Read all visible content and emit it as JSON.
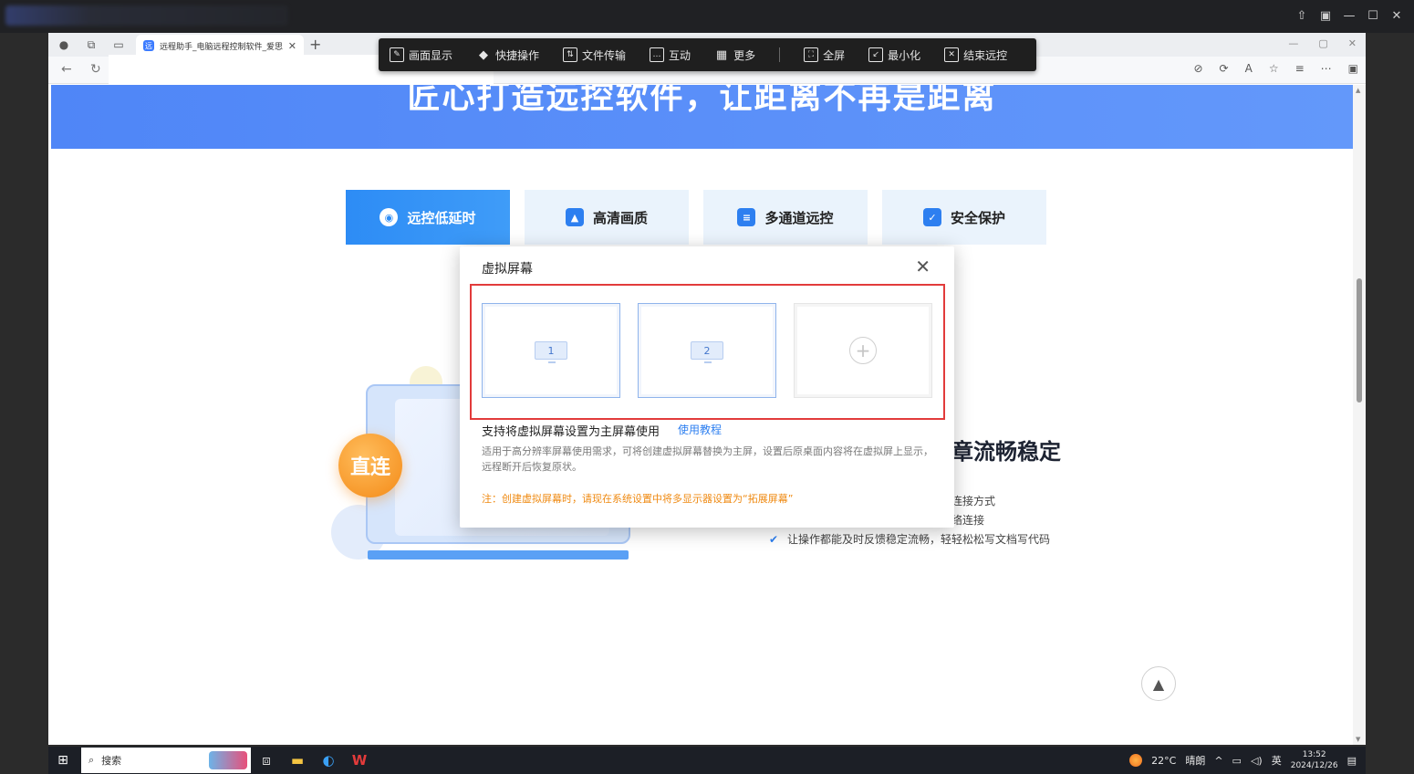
{
  "browser": {
    "tab_title": "远程助手_电脑远程控制软件_爱思",
    "tab_favicon": "远"
  },
  "remote_toolbar": {
    "items": [
      {
        "label": "画面显示",
        "icon": "display-icon"
      },
      {
        "label": "快捷操作",
        "icon": "shortcut-icon"
      },
      {
        "label": "文件传输",
        "icon": "file-transfer-icon"
      },
      {
        "label": "互动",
        "icon": "chat-icon"
      },
      {
        "label": "更多",
        "icon": "grid-icon"
      },
      {
        "label": "全屏",
        "icon": "fullscreen-icon"
      },
      {
        "label": "最小化",
        "icon": "minimize-icon"
      },
      {
        "label": "结束远控",
        "icon": "close-box-icon"
      }
    ]
  },
  "page": {
    "hero_title": "匠心打造远控软件，让距离不再是距离",
    "feature_tabs": [
      {
        "label": "远控低延时",
        "active": true
      },
      {
        "label": "高清画质",
        "active": false
      },
      {
        "label": "多通道远控",
        "active": false
      },
      {
        "label": "安全保护",
        "active": false
      }
    ],
    "illustration_badge": "直连",
    "feature_heading": "章流畅稳定",
    "bullets": [
      "连接方式",
      "络连接",
      "让操作都能及时反馈稳定流畅，轻轻松松写文档写代码"
    ]
  },
  "dialog": {
    "title": "虚拟屏幕",
    "screens": [
      "1",
      "2"
    ],
    "main_text": "支持将虚拟屏幕设置为主屏幕使用",
    "link": "使用教程",
    "description": "适用于高分辨率屏幕使用需求，可将创建虚拟屏幕替换为主屏，设置后原桌面内容将在虚拟屏上显示，远程断开后恢复原状。",
    "note": "注：创建虚拟屏幕时，请现在系统设置中将多显示器设置为“拓展屏幕”"
  },
  "taskbar": {
    "search_placeholder": "搜索",
    "weather": "22°C",
    "weather_desc": "晴朗",
    "ime": "英",
    "time": "13:52",
    "date": "2024/12/26"
  },
  "colors": {
    "accent": "#2d8cf5",
    "highlight_border": "#e23b3b",
    "note": "#ef8a12",
    "hero": "#5a8ff9"
  }
}
